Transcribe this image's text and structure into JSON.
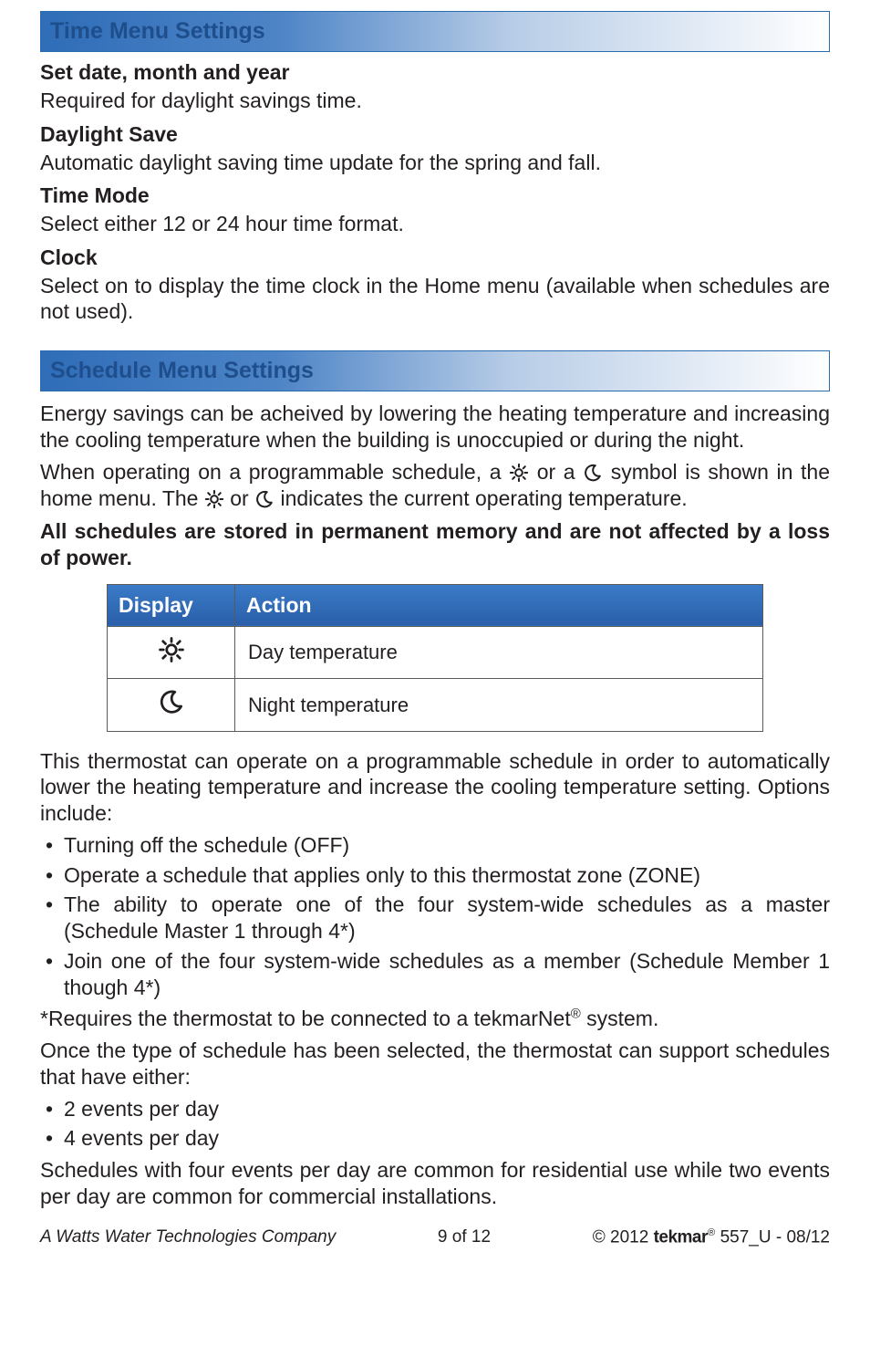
{
  "sections": {
    "time": {
      "title": "Time Menu Settings"
    },
    "schedule": {
      "title": "Schedule Menu Settings"
    }
  },
  "time_items": {
    "set_date": {
      "head": "Set date, month and year",
      "body": "Required for daylight savings time."
    },
    "daylight": {
      "head": "Daylight Save",
      "body": "Automatic daylight saving time update for the spring and fall."
    },
    "mode": {
      "head": "Time Mode",
      "body": "Select either 12 or 24 hour time format."
    },
    "clock": {
      "head": "Clock",
      "body": "Select on to display the time clock in the Home menu (available when schedules are not used)."
    }
  },
  "schedule_intro": {
    "p1": "Energy savings can be acheived by lowering the heating temperature and increasing the cooling temperature when the building is unoccupied or during the night.",
    "p2a": "When operating on a programmable schedule, a ",
    "p2b": " or a ",
    "p2c": " symbol is shown in the home menu. The ",
    "p2d": " or ",
    "p2e": " indicates the current operating temperature.",
    "bold": "All schedules are stored in permanent memory and are not affected by a loss of power."
  },
  "table": {
    "h1": "Display",
    "h2": "Action",
    "r1": "Day temperature",
    "r2": "Night temperature"
  },
  "after_table": {
    "p": "This thermostat can operate on a programmable schedule in order to automatically lower the heating temperature and increase the cooling temperature setting. Options include:",
    "b1": "Turning off the schedule (OFF)",
    "b2": "Operate a schedule that applies only to this thermostat zone (ZONE)",
    "b3": "The ability to operate one of the four system-wide schedules as a master (Schedule Master 1 through 4*)",
    "b4": "Join one of the four system-wide schedules as a member (Schedule Member 1 though 4*)",
    "star_a": "*Requires the thermostat to be connected to a tekmarNet",
    "star_b": " system.",
    "once": "Once the type of schedule has been selected, the thermostat can support schedules that have either:",
    "e1": "2 events per day",
    "e2": "4 events per day",
    "last": "Schedules with four events per day are common for residential use while two events per day are common for commercial installations."
  },
  "footer": {
    "left": "A Watts Water Technologies Company",
    "center": "9 of 12",
    "right_a": "© 2012 ",
    "brand": "tekmar",
    "right_b": " 557_U - 08/12"
  },
  "icons": {
    "sun": "sun-icon",
    "moon": "moon-icon"
  }
}
